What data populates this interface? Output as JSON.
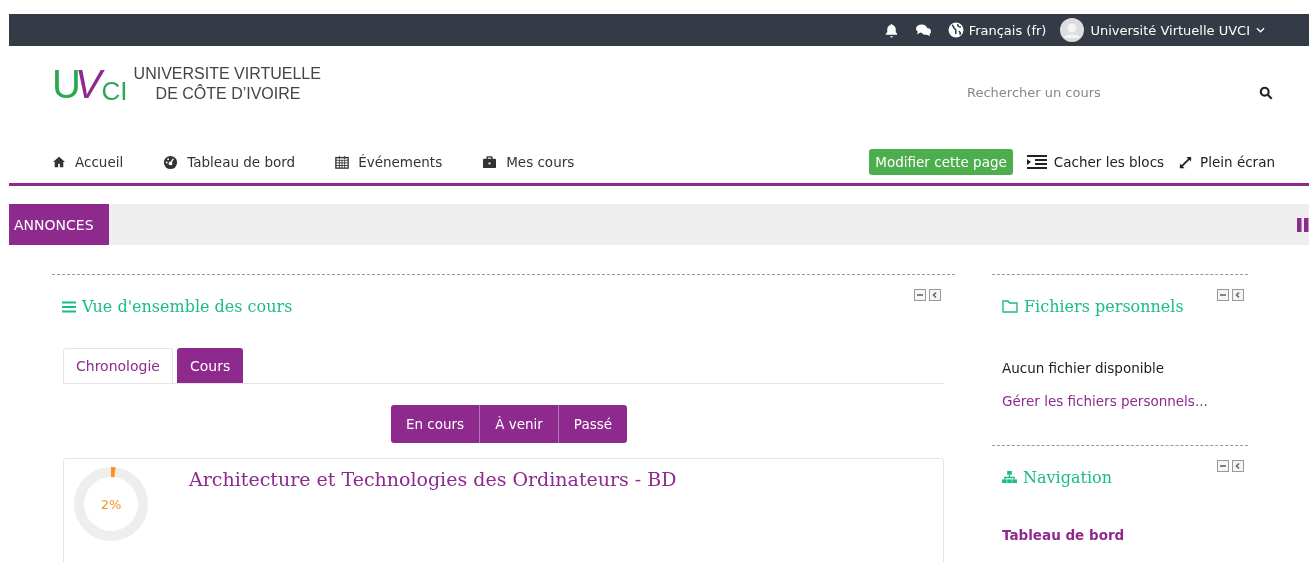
{
  "topbar": {
    "language": "Français (fr)",
    "user": "Université Virtuelle UVCI"
  },
  "logo": {
    "mark_1": "U",
    "mark_2": "V",
    "mark_3": "CI",
    "line_1": "UNIVERSITE VIRTUELLE",
    "line_2": "DE CÔTE D’IVOIRE"
  },
  "search": {
    "placeholder": "Rechercher un cours"
  },
  "nav": [
    {
      "label": "Accueil",
      "kind": "home"
    },
    {
      "label": "Tableau de bord",
      "kind": "dashboard"
    },
    {
      "label": "Événements",
      "kind": "calendar"
    },
    {
      "label": "Mes cours",
      "kind": "briefcase"
    }
  ],
  "actions": {
    "edit": "Modifier cette page",
    "hide_blocks": "Cacher les blocs",
    "fullscreen": "Plein écran"
  },
  "announcements": {
    "label": "ANNONCES"
  },
  "overview": {
    "title": "Vue d'ensemble des cours",
    "tabs": [
      {
        "label": "Chronologie",
        "selected": false
      },
      {
        "label": "Cours",
        "selected": true
      }
    ],
    "filters": [
      "En cours",
      "À venir",
      "Passé"
    ],
    "courses": [
      {
        "name": "Architecture et Technologies des Ordinateurs - BD",
        "progress": "2%",
        "level": 0.02
      }
    ]
  },
  "files": {
    "title": "Fichiers personnels",
    "empty": "Aucun fichier disponible",
    "manage": "Gérer les fichiers personnels..."
  },
  "navigation": {
    "title": "Navigation",
    "items": [
      "Tableau de bord"
    ]
  }
}
